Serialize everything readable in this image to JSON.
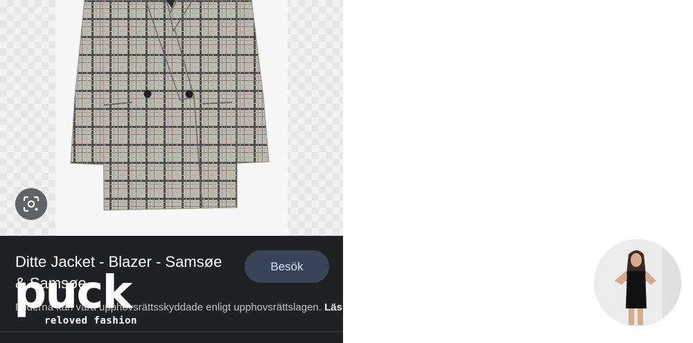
{
  "result": {
    "title": "Ditte Jacket - Blazer - Samsøe & Samsøe",
    "visit_label": "Besök",
    "copyright_notice": "Bilderna kan vara upphovsrättsskyddade enligt upphovsrättslagen.",
    "read_more_label": "Läs mer"
  },
  "watermark": {
    "brand": "puck",
    "tagline": "reloved fashion"
  },
  "icons": {
    "lens": "google-lens-icon"
  },
  "colors": {
    "panel_background": "#202124",
    "visit_button": "#394457",
    "visit_text": "#d2e3fc",
    "lens_button": "#5f6368"
  }
}
